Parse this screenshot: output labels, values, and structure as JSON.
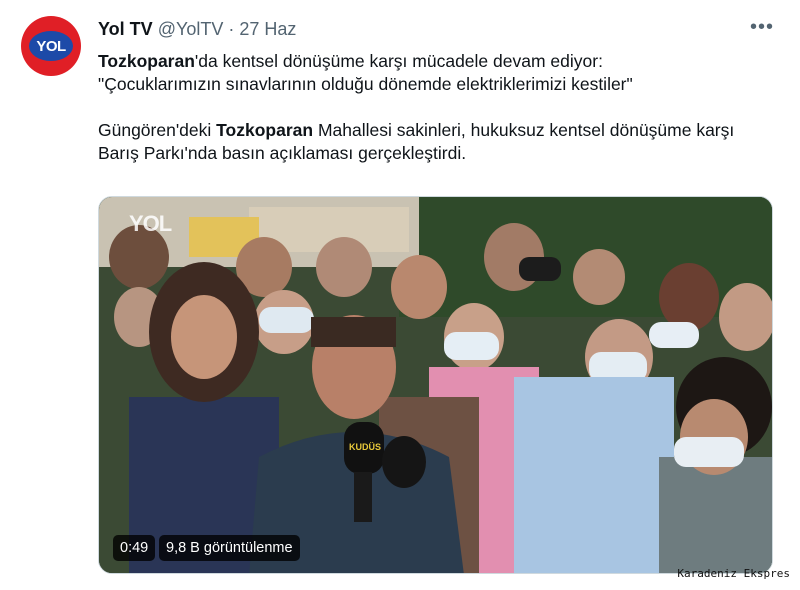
{
  "account": {
    "avatar_text": "YOL",
    "display_name": "Yol TV",
    "handle": "@YolTV",
    "separator": "·",
    "date": "27 Haz"
  },
  "more_icon": "more-horizontal-icon",
  "tweet": {
    "line1_bold": "Tozkoparan",
    "line1_rest": "'da kentsel dönüşüme karşı mücadele devam ediyor:",
    "line2": "\"Çocuklarımızın sınavlarının olduğu dönemde elektriklerimizi kestiler\"",
    "para2_start": "Güngören'deki ",
    "para2_bold": "Tozkoparan",
    "para2_rest": " Mahallesi sakinleri, hukuksuz kentsel dönüşüme karşı Barış Parkı'nda basın açıklaması gerçekleştirdi."
  },
  "video": {
    "logo_text": "YOL",
    "mic_label": "KUDÜS",
    "duration": "0:49",
    "views": "9,8 B görüntülenme"
  },
  "watermark": "Karadeniz Ekspres",
  "colors": {
    "text_primary": "#0f1419",
    "text_secondary": "#536471",
    "avatar_red": "#e01f26",
    "avatar_blue": "#1d4aa8"
  }
}
